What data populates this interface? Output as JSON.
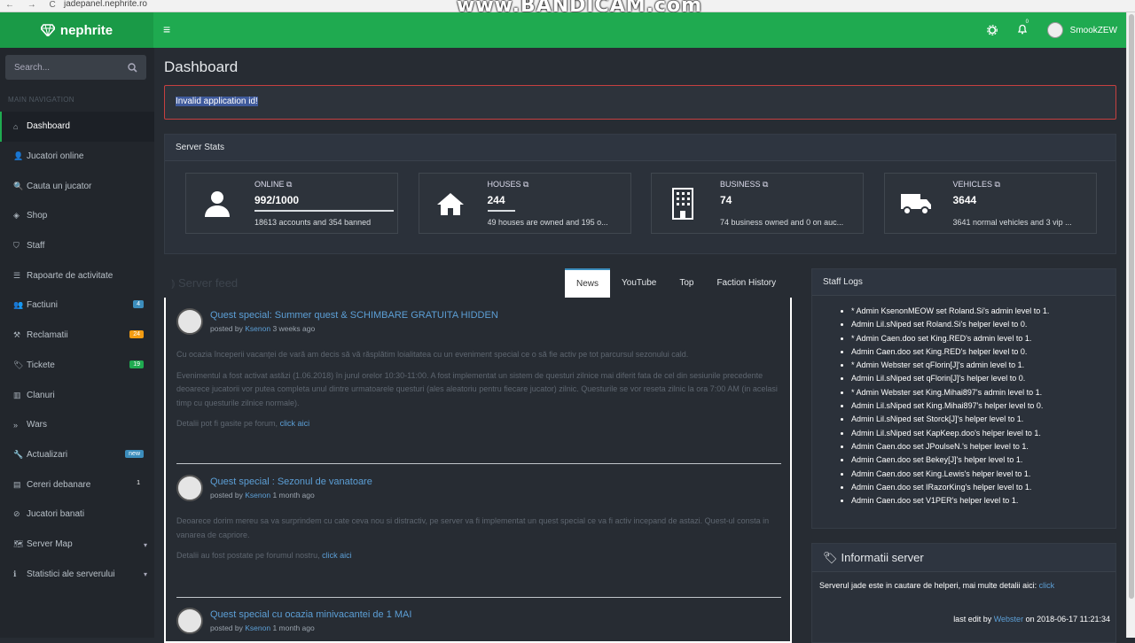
{
  "browser": {
    "url": "jadepanel.nephrite.ro",
    "nav": "← → C"
  },
  "watermark": "www.BANDICAM.com",
  "brand": {
    "name": "nephrite",
    "icon": "diamond-icon"
  },
  "header": {
    "menu_icon": "≡",
    "user": "SmookZEW",
    "notif_count": "0"
  },
  "sidebar": {
    "search_placeholder": "Search...",
    "nav_label": "MAIN NAVIGATION",
    "items": [
      {
        "label": "Dashboard",
        "icon": "⌂",
        "active": true
      },
      {
        "label": "Jucatori online",
        "icon": "👤"
      },
      {
        "label": "Cauta un jucator",
        "icon": "🔍"
      },
      {
        "label": "Shop",
        "icon": "◈"
      },
      {
        "label": "Staff",
        "icon": "⛉"
      },
      {
        "label": "Rapoarte de activitate",
        "icon": "☰"
      },
      {
        "label": "Factiuni",
        "icon": "👥",
        "badge": "4",
        "badge_color": "#3c8dbc"
      },
      {
        "label": "Reclamatii",
        "icon": "⚒",
        "badge": "24",
        "badge_color": "#f39c12"
      },
      {
        "label": "Tickete",
        "icon": "🏷",
        "badge": "19",
        "badge_color": "#1faa50"
      },
      {
        "label": "Clanuri",
        "icon": "▥"
      },
      {
        "label": "Wars",
        "icon": "»"
      },
      {
        "label": "Actualizari",
        "icon": "🔧",
        "badge": "new",
        "badge_color": "#3c8dbc"
      },
      {
        "label": "Cereri debanare",
        "icon": "▤",
        "badge": "1",
        "badge_color": "#22262c"
      },
      {
        "label": "Jucatori banati",
        "icon": "⊘"
      },
      {
        "label": "Server Map",
        "icon": "🗺",
        "caret": "▾"
      },
      {
        "label": "Statistici ale serverului",
        "icon": "ℹ",
        "caret": "▾"
      }
    ]
  },
  "page": {
    "title": "Dashboard",
    "alert": "Invalid application id!"
  },
  "stats": {
    "title": "Server Stats",
    "cards": [
      {
        "label": "ONLINE",
        "value": "992/1000",
        "desc": "18613 accounts and 354 banned",
        "icon": "user-icon",
        "progress": 0.992
      },
      {
        "label": "HOUSES",
        "value": "244",
        "desc": "49 houses are owned and 195 o...",
        "icon": "home-icon",
        "progress": 0.2
      },
      {
        "label": "BUSINESS",
        "value": "74",
        "desc": "74 business owned and 0 on auc...",
        "icon": "building-icon"
      },
      {
        "label": "VEHICLES",
        "value": "3644",
        "desc": "3641 normal vehicles and 3 vip ...",
        "icon": "truck-icon"
      }
    ]
  },
  "feed": {
    "title": "Server feed",
    "tabs": [
      "News",
      "YouTube",
      "Top",
      "Faction History"
    ],
    "posts": [
      {
        "title": "Quest special: Summer quest & SCHIMBARE GRATUITA HIDDEN",
        "author": "Ksenon",
        "when": "3 weeks ago",
        "paragraphs": [
          "Cu ocazia începerii vacanţei de vară am decis să vă răsplătim loialitatea cu un eveniment special ce o să fie activ pe tot parcursul sezonului cald.",
          "Evenimentul a fost activat astăzi (1.06.2018) în jurul orelor 10:30-11:00. A fost implementat un sistem de questuri zilnice mai diferit fata de cel din sesiunile precedente deoarece jucatorii vor putea completa unul dintre urmatoarele questuri (ales aleatoriu pentru fiecare jucator) zilnic. Questurile se vor reseta zilnic la ora 7:00 AM (in acelasi timp cu questurile zilnice normale)."
        ],
        "link_prefix": "Detalii pot fi gasite pe forum, ",
        "link": "click aici"
      },
      {
        "title": "Quest special : Sezonul de vanatoare",
        "author": "Ksenon",
        "when": "1 month ago",
        "paragraphs": [
          "Deoarece dorim mereu sa va surprindem cu cate ceva nou si distractiv, pe server va fi implementat un quest special ce va fi activ incepand de astazi. Quest-ul consta in vanarea de capriore."
        ],
        "link_prefix": "Detalii au fost postate pe forumul nostru, ",
        "link": "click aici"
      },
      {
        "title": "Quest special cu ocazia minivacantei de 1 MAI",
        "author": "Ksenon",
        "when": "1 month ago"
      }
    ]
  },
  "staff_logs": {
    "title": "Staff Logs",
    "entries": [
      "* Admin KsenonMEOW set Roland.Si's admin level to 1.",
      "Admin Lil.sNiped set Roland.Si's helper level to 0.",
      "* Admin Caen.doo set King.RED's admin level to 1.",
      "Admin Caen.doo set King.RED's helper level to 0.",
      "* Admin Webster set qFlorin[J]'s admin level to 1.",
      "Admin Lil.sNiped set qFlorin[J]'s helper level to 0.",
      "* Admin Webster set King.Mihai897's admin level to 1.",
      "Admin Lil.sNiped set King.Mihai897's helper level to 0.",
      "Admin Lil.sNiped set Storck[J]'s helper level to 1.",
      "Admin Lil.sNiped set KapKeep.doo's helper level to 1.",
      "Admin Caen.doo set JPoulseN.'s helper level to 1.",
      "Admin Caen.doo set Bekey[J]'s helper level to 1.",
      "Admin Caen.doo set King.Lewis's helper level to 1.",
      "Admin Caen.doo set IRazorKing's helper level to 1.",
      "Admin Caen.doo set V1PER's helper level to 1."
    ]
  },
  "info": {
    "title": "Informatii server",
    "text": "Serverul jade este in cautare de helperi, mai multe detalii aici: ",
    "link": "click",
    "last_edit_prefix": "last edit by ",
    "last_edit_user": "Webster",
    "last_edit_suffix": " on 2018-06-17 11:21:34"
  }
}
